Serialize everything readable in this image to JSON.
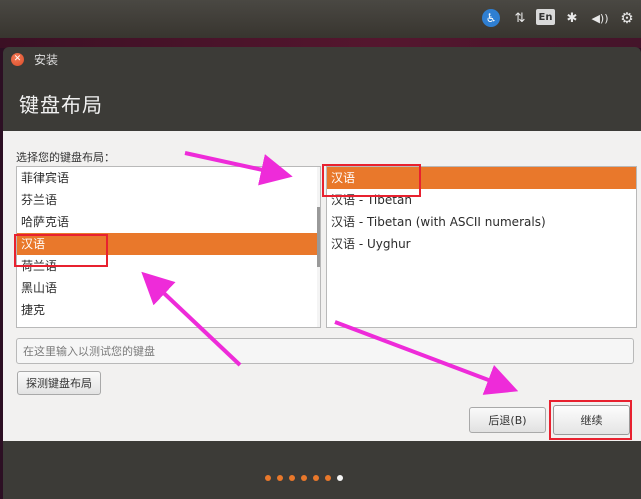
{
  "tray": {
    "language": "En",
    "icons": [
      "accessibility-icon",
      "network-icon",
      "keyboard-language-indicator",
      "bluetooth-icon",
      "volume-icon",
      "gear-icon"
    ]
  },
  "window": {
    "title": "安装",
    "page_title": "键盘布局"
  },
  "layout_prompt": "选择您的键盘布局：",
  "layouts": [
    "菲律宾语",
    "芬兰语",
    "哈萨克语",
    "汉语",
    "荷兰语",
    "黑山语",
    "捷克"
  ],
  "layouts_selected": "汉语",
  "variants": [
    "汉语",
    "汉语 - Tibetan",
    "汉语 - Tibetan (with ASCII numerals)",
    "汉语 - Uyghur"
  ],
  "variants_selected": "汉语",
  "test_input": {
    "value": "",
    "placeholder": "在这里输入以测试您的键盘"
  },
  "buttons": {
    "detect": "探测键盘布局",
    "back": "后退(B)",
    "continue": "继续"
  },
  "progress": {
    "total_steps": 7,
    "current_step": 7
  },
  "colors": {
    "accent": "#e9782b",
    "annotation_box": "#e8212f",
    "annotation_arrow": "#ee2bd9"
  }
}
